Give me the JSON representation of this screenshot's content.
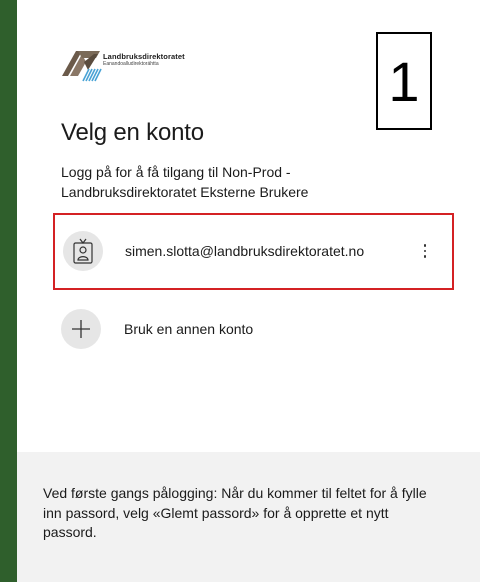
{
  "logo": {
    "title": "Landbruksdirektoratet",
    "subtitle": "Eanandoalludirektoráhtta"
  },
  "badge": {
    "number": "1"
  },
  "page": {
    "title": "Velg en konto",
    "description": "Logg på for å få tilgang til Non-Prod - Landbruksdirektoratet Eksterne Brukere"
  },
  "account": {
    "email": "simen.slotta@landbruksdirektoratet.no",
    "avatar_icon": "id-badge-icon",
    "more_icon": "more-vertical-icon",
    "highlight_color": "#d42124"
  },
  "add_account": {
    "label": "Bruk en annen konto",
    "icon": "plus-icon"
  },
  "footer": {
    "text": "Ved første gangs pålogging: Når du kommer til feltet for å fylle inn passord, velg «Glemt passord» for å opprette et nytt passord."
  }
}
